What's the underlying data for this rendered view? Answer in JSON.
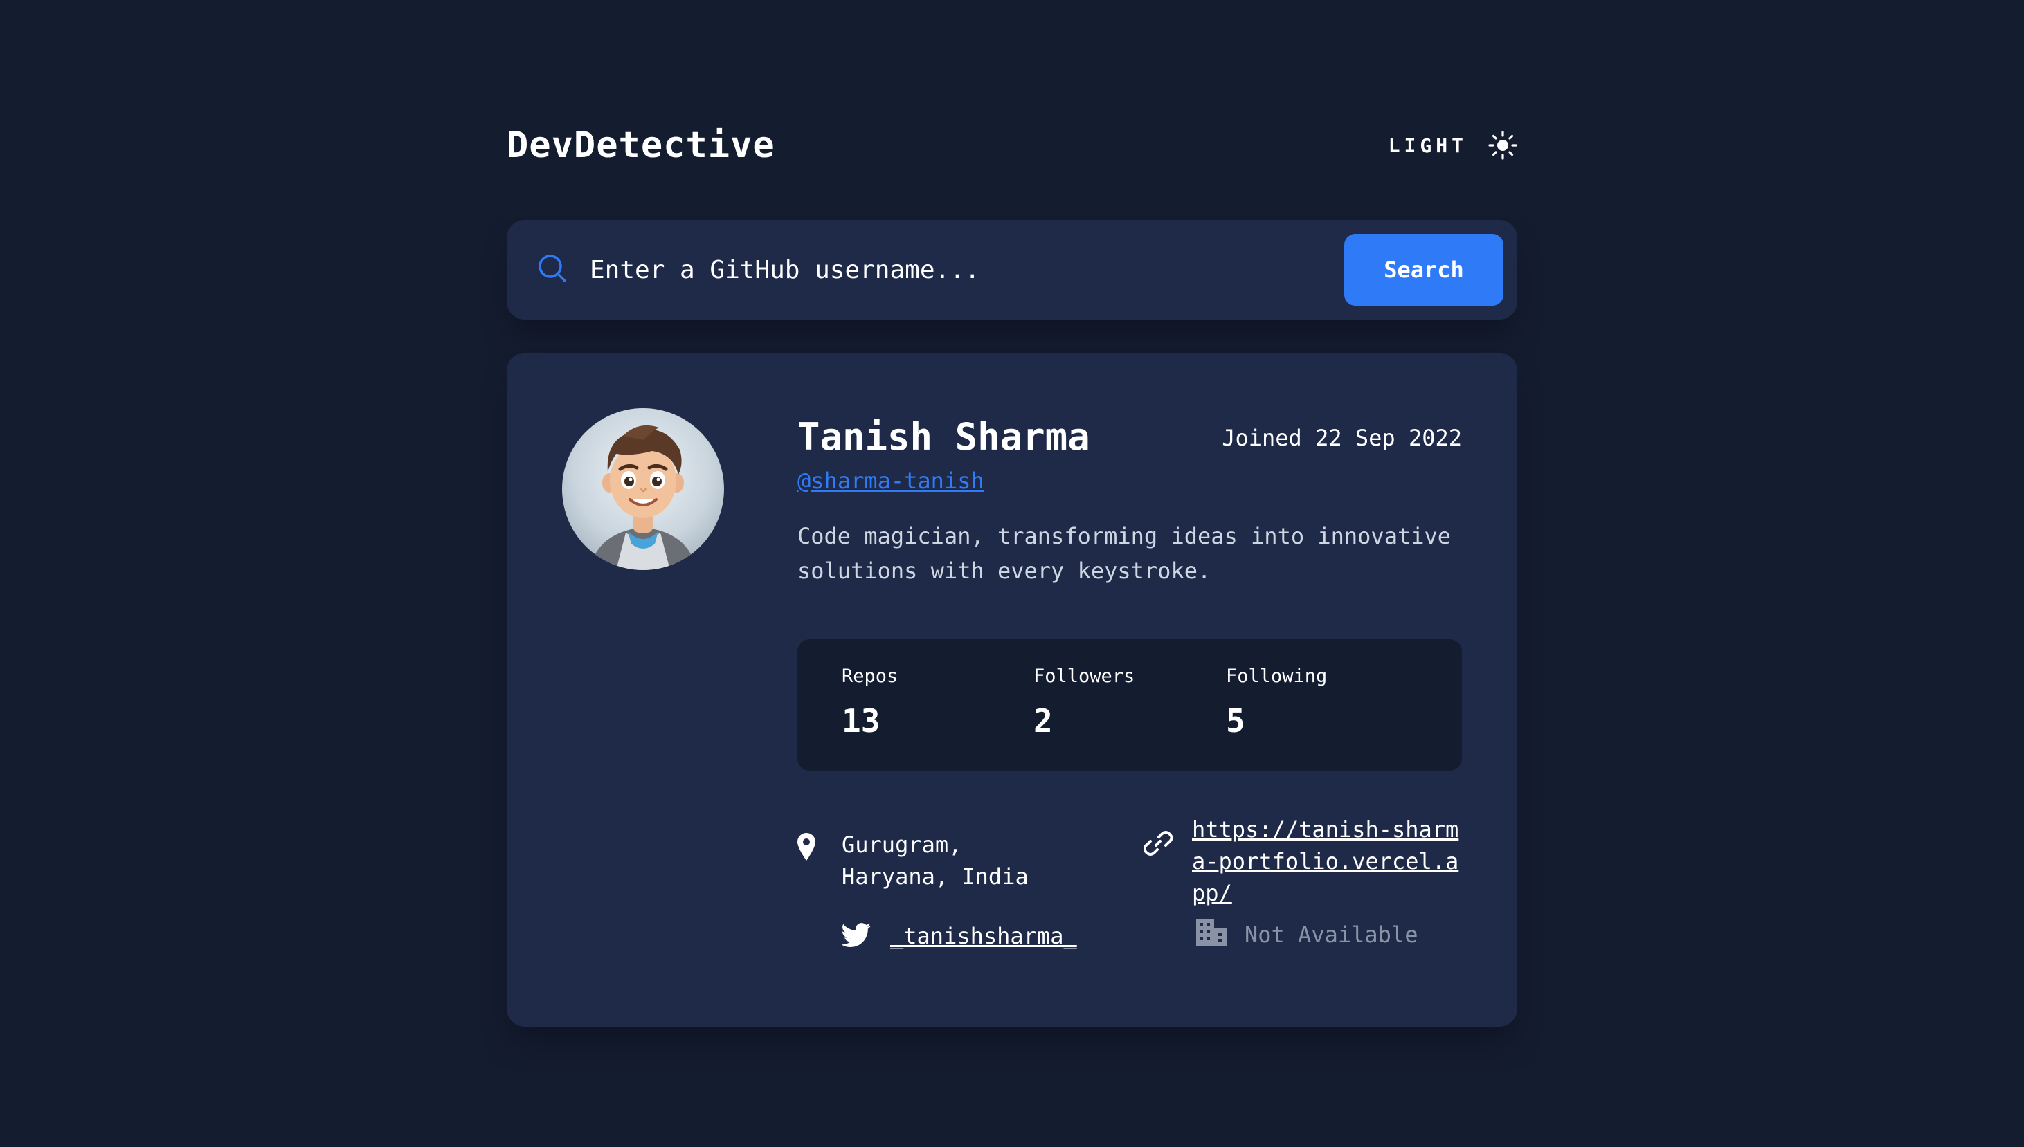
{
  "app": {
    "title": "DevDetective",
    "theme_label": "LIGHT"
  },
  "search": {
    "placeholder": "Enter a GitHub username...",
    "button_label": "Search"
  },
  "profile": {
    "name": "Tanish Sharma",
    "joined": "Joined 22 Sep 2022",
    "handle": "@sharma-tanish",
    "bio": "Code magician, transforming ideas into innovative solutions with every keystroke."
  },
  "stats": [
    {
      "label": "Repos",
      "value": "13"
    },
    {
      "label": "Followers",
      "value": "2"
    },
    {
      "label": "Following",
      "value": "5"
    }
  ],
  "links": {
    "location": "Gurugram, Haryana, India",
    "website": "https://tanish-sharma-portfolio.vercel.app/",
    "twitter": "_tanishsharma_",
    "company": "Not Available"
  },
  "colors": {
    "background": "#141c2f",
    "card": "#1f2a48",
    "accent": "#2f7af7",
    "text": "#ffffff",
    "muted": "#8a93a6"
  },
  "icons": {
    "theme": "sun-icon",
    "search": "search-icon",
    "location": "location-pin-icon",
    "website": "link-icon",
    "twitter": "twitter-icon",
    "company": "building-icon"
  }
}
